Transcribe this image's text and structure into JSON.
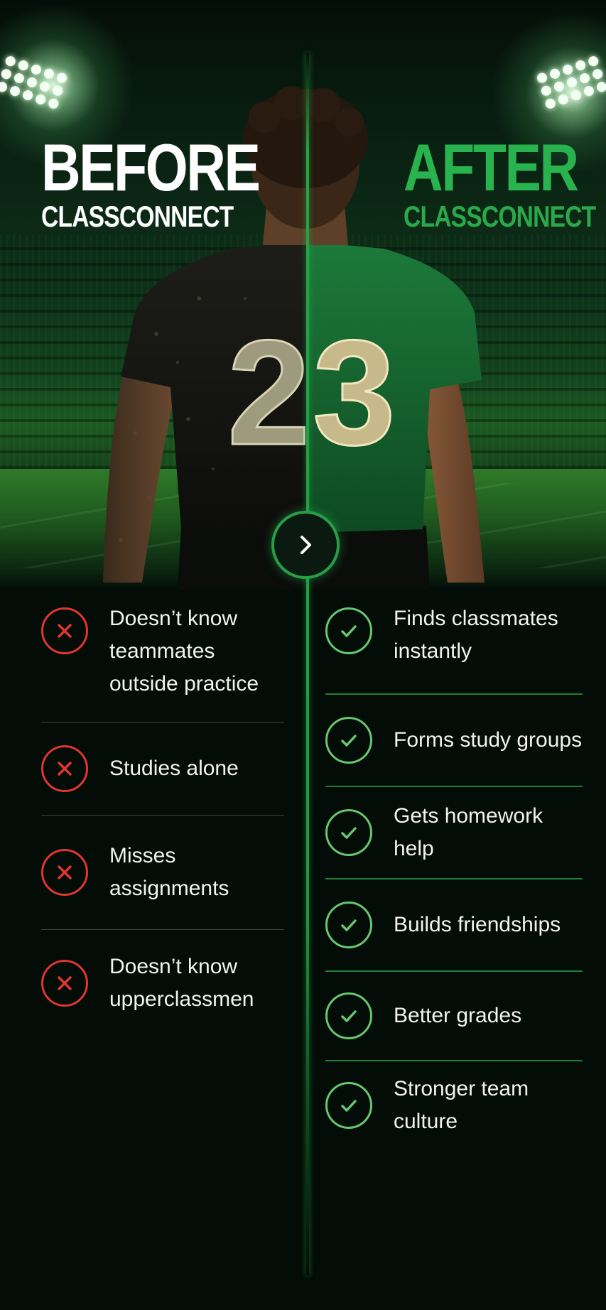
{
  "before": {
    "title": "BEFORE",
    "subtitle": "CLASSCONNECT",
    "items": [
      "Doesn’t know teammates outside practice",
      "Studies alone",
      "Misses assignments",
      "Doesn’t know upperclassmen"
    ]
  },
  "after": {
    "title": "AFTER",
    "subtitle": "CLASSCONNECT",
    "items": [
      "Finds classmates instantly",
      "Forms study groups",
      "Gets homework help",
      "Builds friendships",
      "Better grades",
      "Stronger team culture"
    ]
  },
  "jersey": {
    "left_digit": "2",
    "right_digit": "3"
  },
  "icons": {
    "negative": "x-icon",
    "positive": "check-icon",
    "toggle": "chevron-right-icon"
  },
  "colors": {
    "accent_green": "#29b34f",
    "negative_red": "#e0362d",
    "positive_green": "#67c76e",
    "background": "#030c07"
  }
}
